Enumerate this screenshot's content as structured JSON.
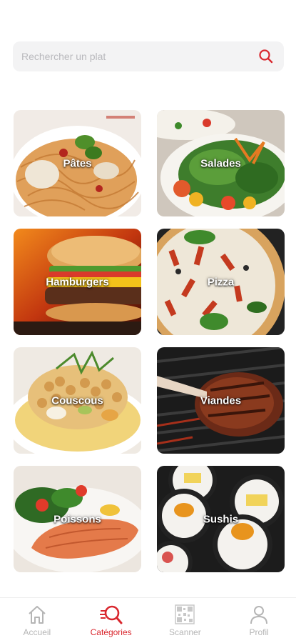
{
  "search": {
    "placeholder": "Rechercher un plat"
  },
  "categories": [
    {
      "label": "Pâtes"
    },
    {
      "label": "Salades"
    },
    {
      "label": "Hamburgers"
    },
    {
      "label": "Pizza"
    },
    {
      "label": "Couscous"
    },
    {
      "label": "Viandes"
    },
    {
      "label": "Poissons"
    },
    {
      "label": "Sushis"
    }
  ],
  "tabbar": {
    "items": [
      {
        "label": "Accueil",
        "icon": "home-icon"
      },
      {
        "label": "Catégories",
        "icon": "search-icon",
        "active": true
      },
      {
        "label": "Scanner",
        "icon": "qr-code-icon"
      },
      {
        "label": "Profil",
        "icon": "user-icon"
      }
    ]
  },
  "colors": {
    "accent": "#d9272e",
    "inactive": "#b5b5b5",
    "search_bg": "#f3f3f4"
  }
}
